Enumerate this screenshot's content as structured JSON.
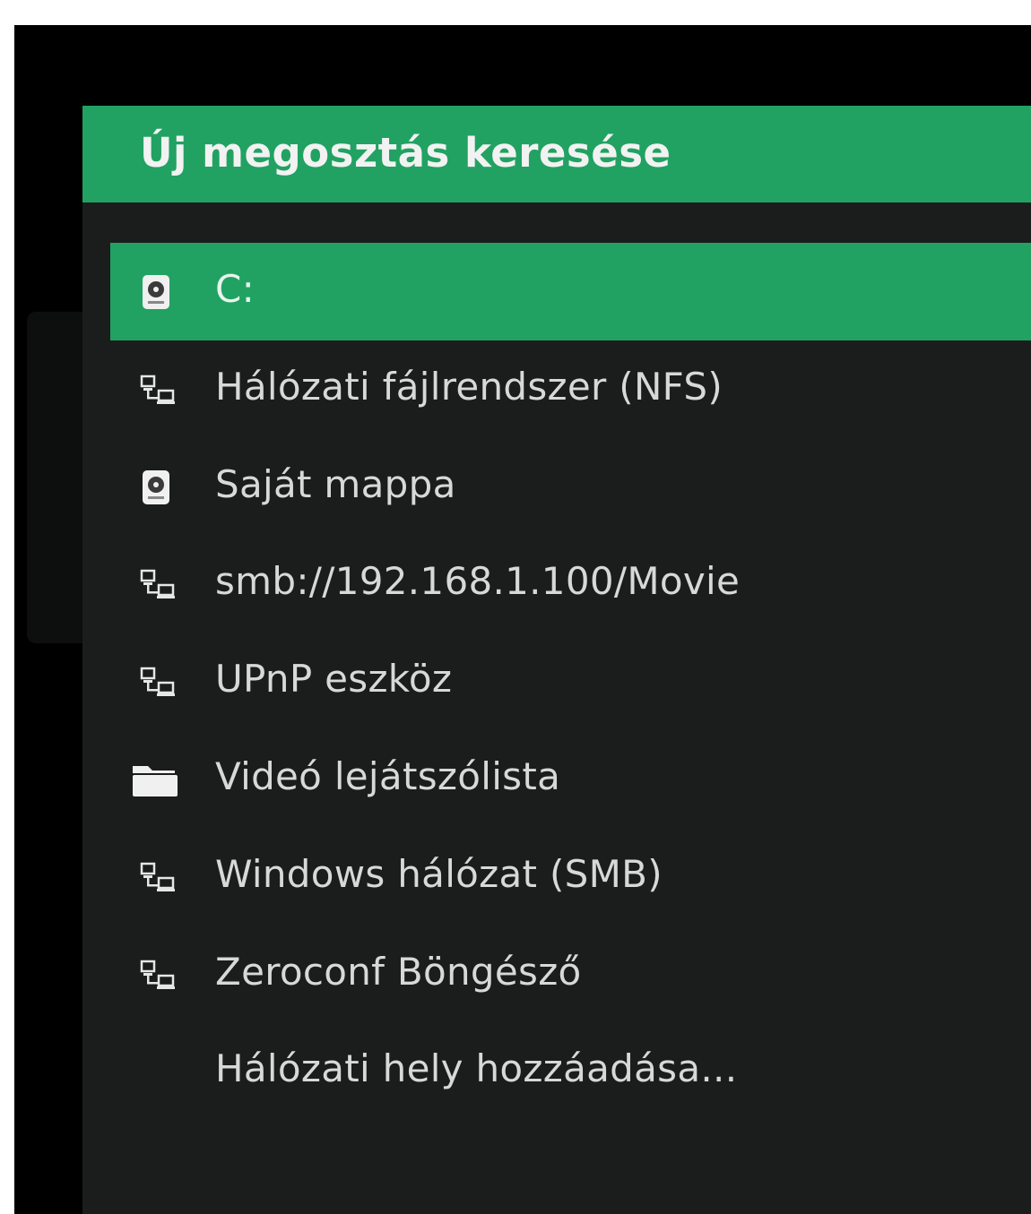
{
  "dialog": {
    "title": "Új megosztás keresése"
  },
  "colors": {
    "accent": "#21a262",
    "dialog_background": "#1a1d1b",
    "text": "#d8d8d8"
  },
  "sources": [
    {
      "label": "C:",
      "icon": "hard-drive-icon",
      "selected": true
    },
    {
      "label": "Hálózati fájlrendszer (NFS)",
      "icon": "network-icon",
      "selected": false
    },
    {
      "label": "Saját mappa",
      "icon": "hard-drive-icon",
      "selected": false
    },
    {
      "label": "smb://192.168.1.100/Movie",
      "icon": "network-icon",
      "selected": false
    },
    {
      "label": "UPnP eszköz",
      "icon": "network-icon",
      "selected": false
    },
    {
      "label": "Videó lejátszólista",
      "icon": "folder-icon",
      "selected": false
    },
    {
      "label": "Windows hálózat (SMB)",
      "icon": "network-icon",
      "selected": false
    },
    {
      "label": "Zeroconf Böngésző",
      "icon": "network-icon",
      "selected": false
    },
    {
      "label": "Hálózati hely hozzáadása...",
      "icon": "",
      "selected": false
    }
  ]
}
